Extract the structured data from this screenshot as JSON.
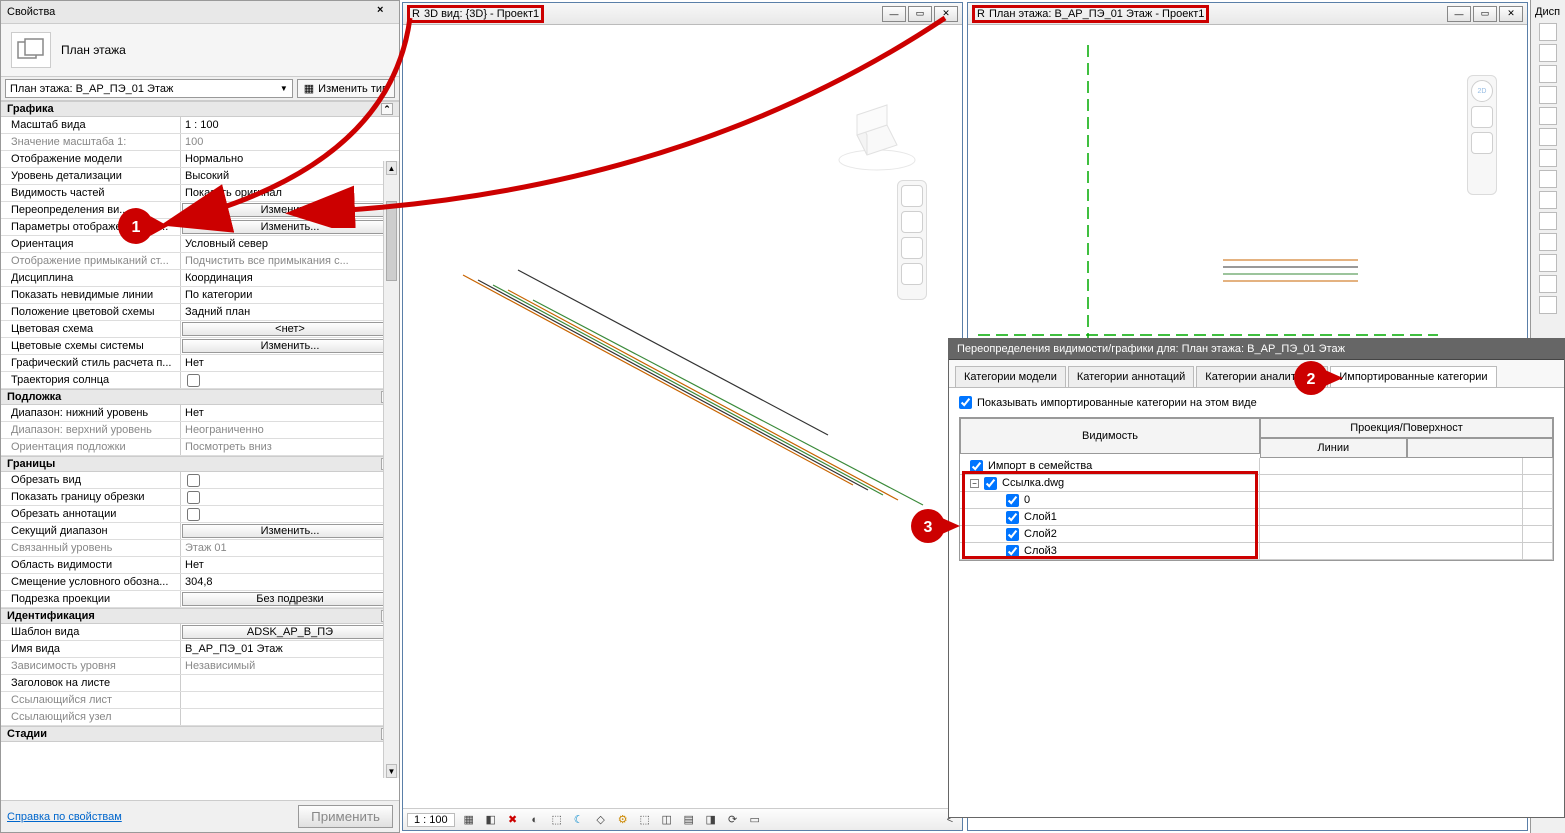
{
  "props_panel": {
    "title": "Свойства",
    "header_label": "План этажа",
    "dropdown": "План этажа: В_АР_ПЭ_01 Этаж",
    "edit_type": "Изменить тип",
    "groups": {
      "graphics": "Графика",
      "underlay": "Подложка",
      "bounds": "Границы",
      "ident": "Идентификация",
      "stages": "Стадии"
    },
    "rows": {
      "scale": {
        "l": "Масштаб вида",
        "v": "1 : 100"
      },
      "scale_val": {
        "l": "Значение масштаба   1:",
        "v": "100"
      },
      "model_disp": {
        "l": "Отображение модели",
        "v": "Нормально"
      },
      "detail": {
        "l": "Уровень детализации",
        "v": "Высокий"
      },
      "part_vis": {
        "l": "Видимость частей",
        "v": "Показать оригинал"
      },
      "vis_override": {
        "l": "Переопределения ви...",
        "v": "Изменить..."
      },
      "graphic_params": {
        "l": "Параметры отображения гра...",
        "v": "Изменить..."
      },
      "orient": {
        "l": "Ориентация",
        "v": "Условный север"
      },
      "join_disp": {
        "l": "Отображение примыканий ст...",
        "v": "Подчистить все примыкания с..."
      },
      "discipline": {
        "l": "Дисциплина",
        "v": "Координация"
      },
      "show_hidden": {
        "l": "Показать невидимые линии",
        "v": "По категории"
      },
      "color_pos": {
        "l": "Положение цветовой схемы",
        "v": "Задний план"
      },
      "color_scheme": {
        "l": "Цветовая схема",
        "v": "<нет>"
      },
      "sys_color": {
        "l": "Цветовые схемы системы",
        "v": "Изменить..."
      },
      "calc_style": {
        "l": "Графический стиль расчета п...",
        "v": "Нет"
      },
      "sun_path": {
        "l": "Траектория солнца",
        "v": ""
      },
      "range_lo": {
        "l": "Диапазон: нижний уровень",
        "v": "Нет"
      },
      "range_hi": {
        "l": "Диапазон: верхний уровень",
        "v": "Неограниченно"
      },
      "under_orient": {
        "l": "Ориентация подложки",
        "v": "Посмотреть вниз"
      },
      "crop": {
        "l": "Обрезать вид",
        "v": ""
      },
      "crop_bound": {
        "l": "Показать границу обрезки",
        "v": ""
      },
      "crop_annot": {
        "l": "Обрезать аннотации",
        "v": ""
      },
      "section_range": {
        "l": "Секущий диапазон",
        "v": "Изменить..."
      },
      "assoc_lvl": {
        "l": "Связанный уровень",
        "v": "Этаж 01"
      },
      "vis_area": {
        "l": "Область видимости",
        "v": "Нет"
      },
      "offset": {
        "l": "Смещение условного обозна...",
        "v": "304,8"
      },
      "proj_clip": {
        "l": "Подрезка проекции",
        "v": "Без подрезки"
      },
      "template": {
        "l": "Шаблон вида",
        "v": "ADSK_АР_В_ПЭ"
      },
      "view_name": {
        "l": "Имя вида",
        "v": "В_АР_ПЭ_01 Этаж"
      },
      "dependency": {
        "l": "Зависимость уровня",
        "v": "Независимый"
      },
      "sheet_title": {
        "l": "Заголовок на листе",
        "v": ""
      },
      "ref_sheet": {
        "l": "Ссылающийся лист",
        "v": ""
      },
      "ref_node": {
        "l": "Ссылающийся узел",
        "v": ""
      }
    },
    "help_link": "Справка по свойствам",
    "apply": "Применить"
  },
  "view3d": {
    "title": "3D вид: {3D} - Проект1",
    "scale": "1 : 100"
  },
  "viewplan": {
    "title": "План этажа: В_АР_ПЭ_01 Этаж - Проект1"
  },
  "right_stub": {
    "title": "Дисп"
  },
  "visibility_dialog": {
    "title": "Переопределения видимости/графики для: План этажа: В_АР_ПЭ_01 Этаж",
    "tabs": {
      "model": "Категории модели",
      "annot": "Категории аннотаций",
      "analytic": "Категории аналитичес",
      "imported": "Импортированные категории"
    },
    "show_imported": "Показывать импортированные категории на этом виде",
    "col_vis": "Видимость",
    "col_proj": "Проекция/Поверхност",
    "col_lines": "Линии",
    "rows": {
      "import_fam": "Импорт в семейства",
      "link": "Ссылка.dwg",
      "l0": "0",
      "l1": "Слой1",
      "l2": "Слой2",
      "l3": "Слой3"
    }
  },
  "callouts": {
    "c1": "1",
    "c2": "2",
    "c3": "3"
  },
  "nav2d_label": "2D"
}
